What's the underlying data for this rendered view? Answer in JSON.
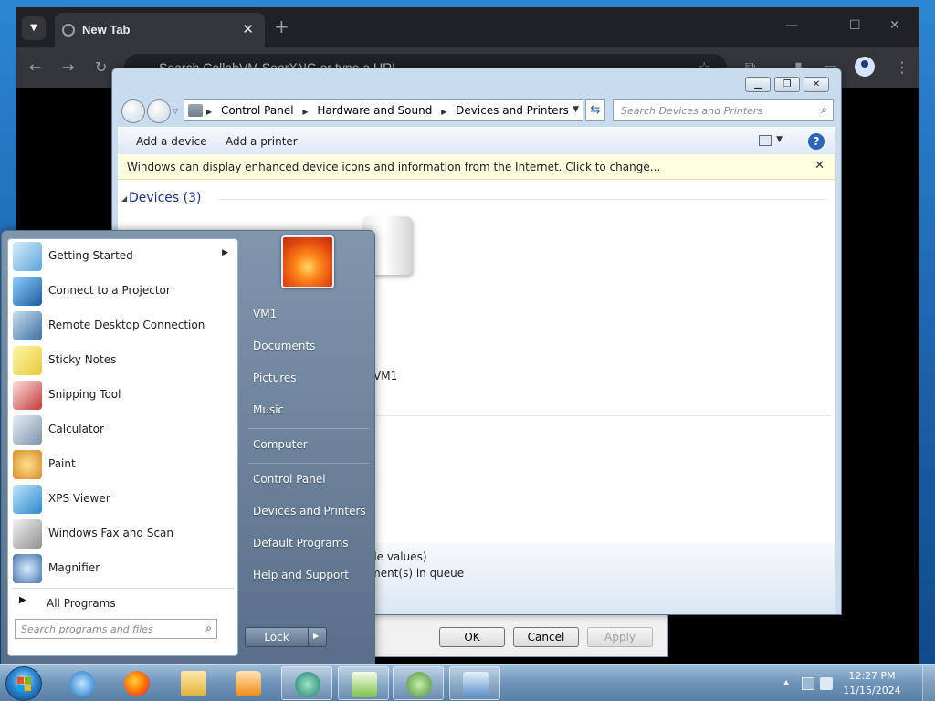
{
  "browser": {
    "tab_title": "New Tab",
    "omnibox_placeholder": "Search CollabVM SearXNG or type a URL"
  },
  "control_panel": {
    "breadcrumb": [
      "Control Panel",
      "Hardware and Sound",
      "Devices and Printers"
    ],
    "search_placeholder": "Search Devices and Printers",
    "commands": [
      "Add a device",
      "Add a printer"
    ],
    "info_message": "Windows can display enhanced device icons and information from the Internet. Click to change...",
    "group_header": "Devices (3)",
    "device_label": "VM1",
    "details_line1": "de values)",
    "details_line2": "ment(s) in queue"
  },
  "dialog": {
    "ok": "OK",
    "cancel": "Cancel",
    "apply": "Apply"
  },
  "start_menu": {
    "programs": [
      {
        "label": "Getting Started",
        "icon": "getting-started-icon",
        "has_submenu": true
      },
      {
        "label": "Connect to a Projector",
        "icon": "projector-icon"
      },
      {
        "label": "Remote Desktop Connection",
        "icon": "remote-desktop-icon"
      },
      {
        "label": "Sticky Notes",
        "icon": "sticky-notes-icon"
      },
      {
        "label": "Snipping Tool",
        "icon": "snipping-tool-icon"
      },
      {
        "label": "Calculator",
        "icon": "calculator-icon"
      },
      {
        "label": "Paint",
        "icon": "paint-icon"
      },
      {
        "label": "XPS Viewer",
        "icon": "xps-viewer-icon"
      },
      {
        "label": "Windows Fax and Scan",
        "icon": "fax-scan-icon"
      },
      {
        "label": "Magnifier",
        "icon": "magnifier-icon"
      }
    ],
    "all_programs": "All Programs",
    "search_placeholder": "Search programs and files",
    "right": [
      "VM1",
      "Documents",
      "Pictures",
      "Music",
      "Computer",
      "Control Panel",
      "Devices and Printers",
      "Default Programs",
      "Help and Support"
    ],
    "lock_label": "Lock"
  },
  "taskbar": {
    "time": "12:27 PM",
    "date": "11/15/2024",
    "pinned": [
      "internet-explorer-icon",
      "firefox-icon",
      "file-explorer-icon",
      "media-player-icon",
      "paint-dot-net-icon",
      "notepad-plus-plus-icon",
      "virtualbox-icon",
      "control-panel-icon"
    ]
  }
}
